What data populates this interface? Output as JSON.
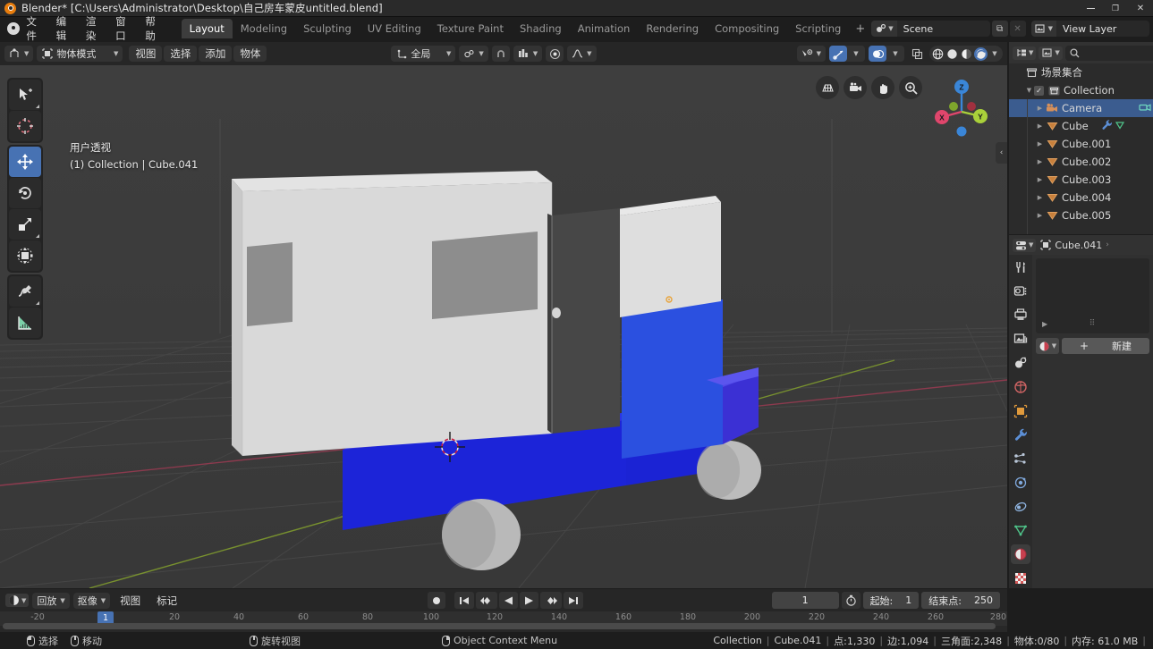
{
  "window": {
    "title": "Blender* [C:\\Users\\Administrator\\Desktop\\自己房车蒙皮untitled.blend]",
    "minimize": "–",
    "maximize": "□",
    "close": "✕"
  },
  "topbar": {
    "menus": [
      "文件",
      "编辑",
      "渲染",
      "窗口",
      "帮助"
    ],
    "workspaces": [
      {
        "label": "Layout",
        "active": true
      },
      {
        "label": "Modeling",
        "active": false
      },
      {
        "label": "Sculpting",
        "active": false
      },
      {
        "label": "UV Editing",
        "active": false
      },
      {
        "label": "Texture Paint",
        "active": false
      },
      {
        "label": "Shading",
        "active": false
      },
      {
        "label": "Animation",
        "active": false
      },
      {
        "label": "Rendering",
        "active": false
      },
      {
        "label": "Compositing",
        "active": false
      },
      {
        "label": "Scripting",
        "active": false
      }
    ],
    "add_workspace": "+",
    "scene_name": "Scene",
    "view_layer_name": "View Layer",
    "new_scene_label": "⧉",
    "remove_scene_label": "✕"
  },
  "viewport_header": {
    "mode": "物体模式",
    "menus": [
      "视图",
      "选择",
      "添加",
      "物体"
    ],
    "transform_orientation": "全局",
    "snap_label": "磁吸",
    "proportional_label": "衰减编辑"
  },
  "viewport": {
    "perspective_label": "用户透视",
    "scene_info": "(1) Collection | Cube.041",
    "tools": [
      {
        "name": "tweak-tool",
        "active": false
      },
      {
        "name": "cursor-tool",
        "active": false
      },
      {
        "name": "move-tool",
        "active": true
      },
      {
        "name": "rotate-tool",
        "active": false
      },
      {
        "name": "scale-tool",
        "active": false
      },
      {
        "name": "transform-tool",
        "active": false
      },
      {
        "name": "annotate-tool",
        "active": false
      },
      {
        "name": "measure-tool",
        "active": false
      }
    ],
    "gizmo_axes": [
      "X",
      "Y",
      "Z"
    ],
    "colors": {
      "axis_x": "#e0466c",
      "axis_y": "#a9d03a",
      "axis_z": "#3a86d8",
      "background": "#3b3b3b",
      "body_white": "#d8d8d8",
      "chassis_blue": "#1c24d8",
      "cab_blue": "#2b50e0",
      "door_dark": "#474747",
      "window_gray": "#8d8d8d",
      "wheel_gray": "#b9b9b9"
    },
    "collapse_arrow": "‹"
  },
  "outliner": {
    "display_mode": "view-layer",
    "search_placeholder": "",
    "root": "场景集合",
    "items": [
      {
        "label": "Collection",
        "depth": 1,
        "type": "collection",
        "selected": false,
        "checkbox": true
      },
      {
        "label": "Camera",
        "depth": 2,
        "type": "camera",
        "selected": true
      },
      {
        "label": "Cube",
        "depth": 2,
        "type": "mesh",
        "selected": false,
        "modifier": true
      },
      {
        "label": "Cube.001",
        "depth": 2,
        "type": "mesh",
        "selected": false
      },
      {
        "label": "Cube.002",
        "depth": 2,
        "type": "mesh",
        "selected": false
      },
      {
        "label": "Cube.003",
        "depth": 2,
        "type": "mesh",
        "selected": false
      },
      {
        "label": "Cube.004",
        "depth": 2,
        "type": "mesh",
        "selected": false
      },
      {
        "label": "Cube.005",
        "depth": 2,
        "type": "mesh",
        "selected": false
      }
    ]
  },
  "properties": {
    "breadcrumb_object": "Cube.041",
    "breadcrumb_sep": "›",
    "tabs": [
      {
        "name": "tool-tab",
        "glyph": "⚒",
        "active": false
      },
      {
        "name": "render-tab",
        "glyph": "▣",
        "active": false
      },
      {
        "name": "output-tab",
        "glyph": "🖨",
        "active": false
      },
      {
        "name": "view-layer-tab",
        "glyph": "🖼",
        "active": false
      },
      {
        "name": "scene-tab",
        "glyph": "◉",
        "active": false
      },
      {
        "name": "world-tab",
        "glyph": "◍",
        "active": false
      },
      {
        "name": "object-tab",
        "glyph": "▢",
        "active": false
      },
      {
        "name": "modifier-tab",
        "glyph": "🔧",
        "active": false
      },
      {
        "name": "particles-tab",
        "glyph": "⁂",
        "active": false
      },
      {
        "name": "physics-tab",
        "glyph": "◌",
        "active": false
      },
      {
        "name": "constraints-tab",
        "glyph": "⟲",
        "active": false
      },
      {
        "name": "data-tab",
        "glyph": "▽",
        "active": false
      },
      {
        "name": "material-tab",
        "glyph": "◕",
        "active": true
      },
      {
        "name": "texture-tab",
        "glyph": "▦",
        "active": false
      }
    ],
    "new_material_label": "新建",
    "add_slot_label": "+",
    "browse_label": "⌄"
  },
  "timeline": {
    "editor_type": "timeline",
    "menus": [
      "回放",
      "抠像",
      "视图",
      "标记"
    ],
    "playback_buttons": [
      "⏺",
      "⏮",
      "⏪",
      "◀",
      "▶",
      "⏩",
      "⏭"
    ],
    "current_frame": "1",
    "start_label": "起始:",
    "start_value": "1",
    "end_label": "结束点:",
    "end_value": "250",
    "ruler_ticks": [
      "-20",
      "20",
      "40",
      "60",
      "80",
      "100",
      "120",
      "140",
      "160",
      "180",
      "200",
      "220",
      "240",
      "260",
      "280"
    ],
    "playhead_frame": "1"
  },
  "statusbar": {
    "hints": [
      {
        "mouse": "l",
        "label": "选择"
      },
      {
        "mouse": "m",
        "label": "移动"
      },
      {
        "mouse": "m2",
        "label": "旋转视图"
      },
      {
        "mouse": "r",
        "label": "Object Context Menu"
      }
    ],
    "stats": [
      "Collection",
      "Cube.041",
      "点:1,330",
      "边:1,094",
      "三角面:2,348",
      "物体:0/80",
      "内存: 61.0 MB"
    ]
  }
}
